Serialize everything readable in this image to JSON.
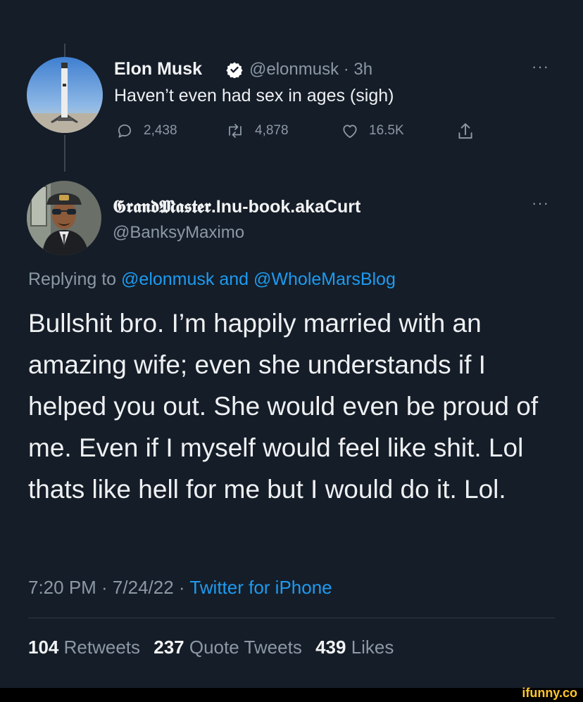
{
  "tweet1": {
    "name": "Elon Musk",
    "handle_time": "@elonmusk · 3h",
    "text": "Haven’t even had sex in ages (sigh)",
    "replies": "2,438",
    "retweets": "4,878",
    "likes": "16.5K",
    "verified_color": "#ffffff"
  },
  "tweet2": {
    "name_gothic": "𝕲𝖗𝖆𝖓𝖉𝕸𝖆𝖘𝖙𝖊𝖗",
    "name_rest": ".Inu-book.akaCurt",
    "handle": "@BanksyMaximo",
    "replying_prefix": "Replying to",
    "replying_user1": "@elonmusk",
    "replying_and": "and",
    "replying_user2": "@WholeMarsBlog",
    "text": "Bullshit bro. I’m happily married with an amazing wife; even she understands if I helped you out. She would even be proud of me. Even if I myself would feel like shit. Lol thats like hell for me but I would do it. Lol.",
    "timestamp": "7:20 PM · 7/24/22 ·",
    "source": "Twitter for iPhone"
  },
  "stats": {
    "retweets_count": "104",
    "retweets_label": "Retweets",
    "quotes_count": "237",
    "quotes_label": "Quote Tweets",
    "likes_count": "439",
    "likes_label": "Likes"
  },
  "more_label": "···",
  "watermark": "ifunny.co",
  "colors": {
    "background": "#151d28",
    "link": "#1d9bf0",
    "muted": "#8b98a5"
  }
}
